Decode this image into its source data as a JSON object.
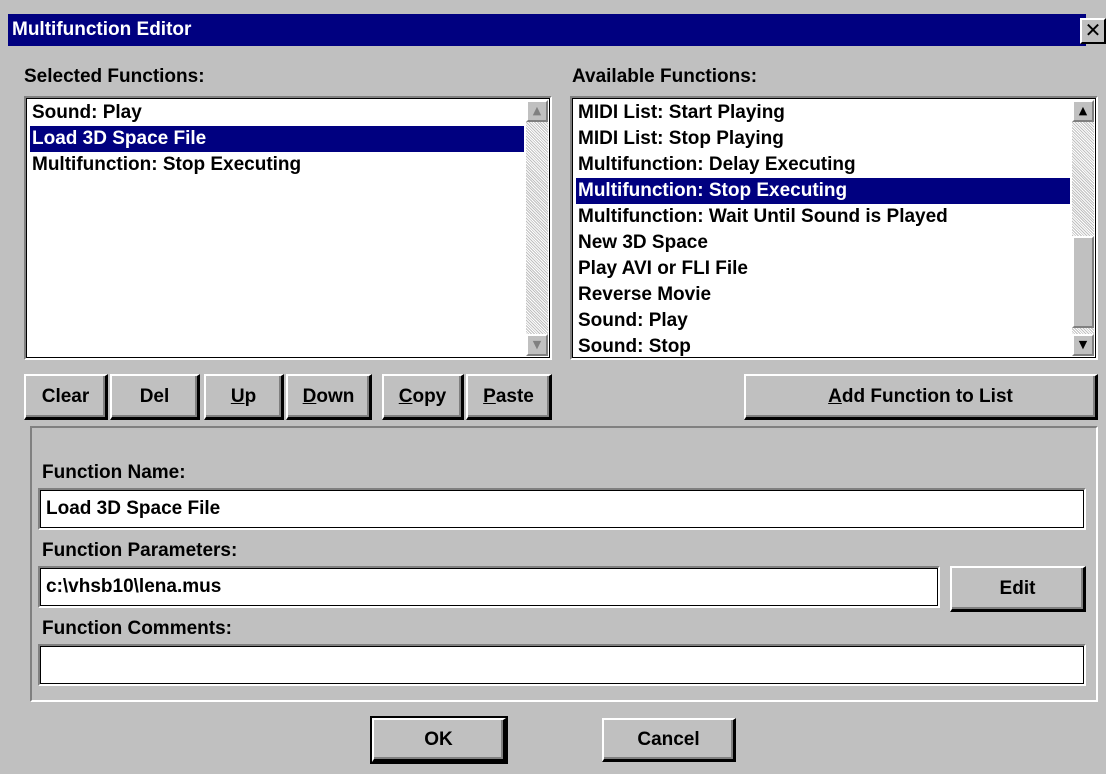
{
  "window": {
    "title": "Multifunction Editor",
    "close_glyph": "✕"
  },
  "selected": {
    "label": "Selected Functions:",
    "items": [
      "Sound: Play",
      "Load 3D Space File",
      "Multifunction: Stop Executing"
    ],
    "selected_index": 1
  },
  "available": {
    "label": "Available Functions:",
    "items": [
      "MIDI List: Start Playing",
      "MIDI List: Stop Playing",
      "Multifunction: Delay Executing",
      "Multifunction: Stop Executing",
      "Multifunction: Wait Until Sound is Played",
      "New 3D Space",
      "Play AVI or FLI File",
      "Reverse Movie",
      "Sound: Play",
      "Sound: Stop"
    ],
    "selected_index": 3
  },
  "buttons": {
    "clear": "Clear",
    "del": "Del",
    "up": {
      "mnemonic": "U",
      "rest": "p"
    },
    "down": {
      "mnemonic": "D",
      "rest": "own"
    },
    "copy": {
      "mnemonic": "C",
      "rest": "opy"
    },
    "paste": {
      "mnemonic": "P",
      "rest": "aste"
    },
    "add": {
      "mnemonic": "A",
      "rest": "dd Function to List"
    },
    "edit": "Edit",
    "ok": "OK",
    "cancel": "Cancel"
  },
  "form": {
    "name_label": "Function Name:",
    "name_value": "Load 3D Space File",
    "params_label": "Function Parameters:",
    "params_value": "c:\\vhsb10\\lena.mus",
    "comments_label": "Function Comments:",
    "comments_value": ""
  },
  "icons": {
    "scroll_up": "▲",
    "scroll_down": "▼"
  }
}
